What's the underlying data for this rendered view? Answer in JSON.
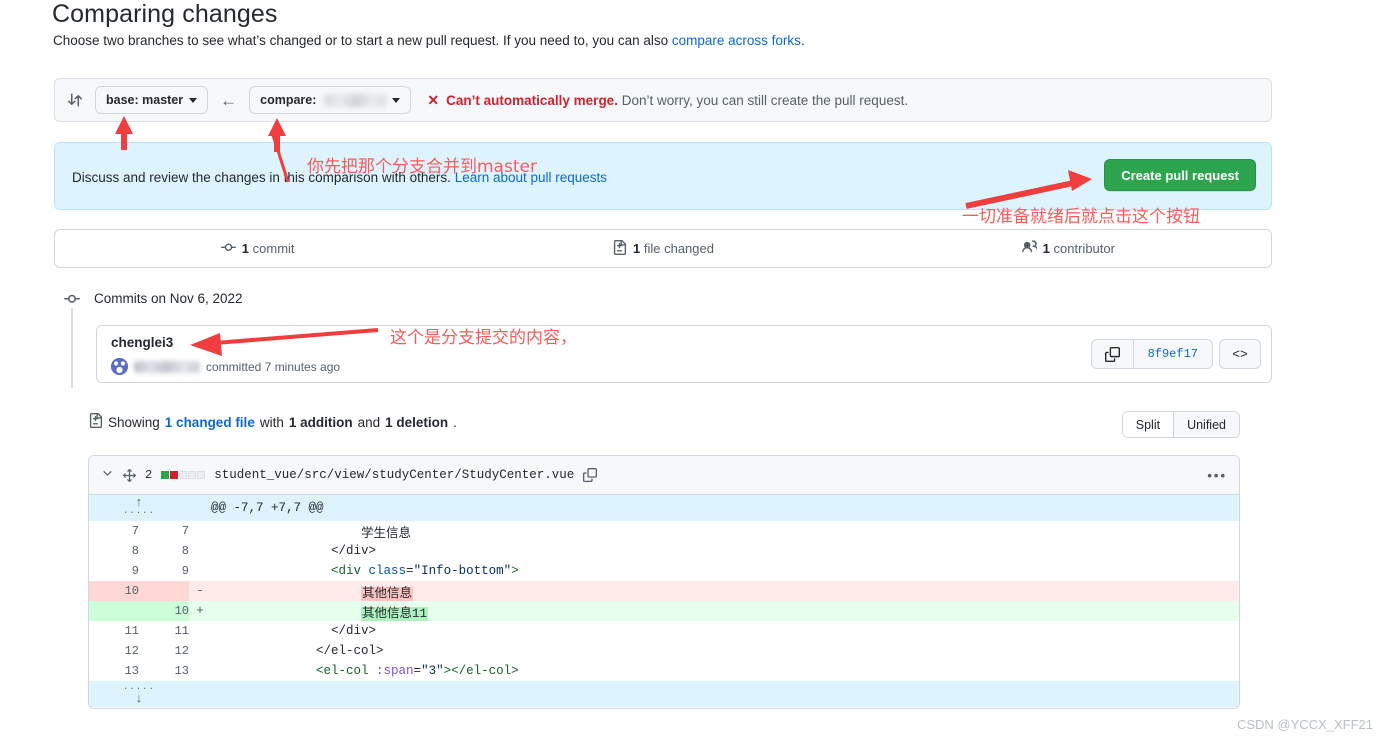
{
  "header": {
    "title": "Comparing changes",
    "subtitle_pre": "Choose two branches to see what’s changed or to start a new pull request. If you need to, you can also ",
    "subtitle_link": "compare across forks",
    "subtitle_post": "."
  },
  "branch_bar": {
    "compare_icon": "git-compare-icon",
    "base_label": "base: master",
    "arrow": "←",
    "compare_label": "compare:",
    "compare_value_blurred": true,
    "merge_x": "✕",
    "merge_status": "Can’t automatically merge.",
    "merge_rest": " Don’t worry, you can still create the pull request."
  },
  "info_banner": {
    "text": "Discuss and review the changes in this comparison with others. ",
    "link": "Learn about pull requests",
    "create_pr_label": "Create pull request"
  },
  "stats": [
    {
      "icon": "commit-icon",
      "count": "1",
      "label": "commit"
    },
    {
      "icon": "file-diff-icon",
      "count": "1",
      "label": "file changed"
    },
    {
      "icon": "people-icon",
      "count": "1",
      "label": "contributor"
    }
  ],
  "commits": {
    "date_header": "Commits on Nov 6, 2022",
    "message": "chenglei3",
    "author_blurred": true,
    "committed_text": "committed 7 minutes ago",
    "sha": "8f9ef17",
    "copy_icon": "copy-icon",
    "code_icon": "<>"
  },
  "showing": {
    "icon": "file-diff-icon",
    "pre": "Showing ",
    "changed_file": "1 changed file",
    "mid": " with ",
    "additions": "1 addition",
    "and": " and ",
    "deletions": "1 deletion",
    "end": ".",
    "split_label": "Split",
    "unified_label": "Unified"
  },
  "diff": {
    "chevron_icon": "chevron-down-icon",
    "move_icon": "move-icon",
    "stat_count": "2",
    "stat_blocks": [
      "add",
      "del",
      "neutral",
      "neutral",
      "neutral"
    ],
    "file_path": "student_vue/src/view/studyCenter/StudyCenter.vue",
    "copy_icon": "copy-icon",
    "kebab_icon": "kebab-horizontal-icon",
    "hunk_header": "@@ -7,7 +7,7 @@",
    "expand_up_icon": "↑",
    "expand_down_icon": "↓",
    "rows": [
      {
        "type": "ctx",
        "old": "7",
        "new": "7",
        "marker": "",
        "code": "                    学生信息"
      },
      {
        "type": "ctx",
        "old": "8",
        "new": "8",
        "marker": "",
        "code": "                </div>"
      },
      {
        "type": "ctx",
        "old": "9",
        "new": "9",
        "marker": "",
        "code": "                <div class=\"Info-bottom\">"
      },
      {
        "type": "del",
        "old": "10",
        "new": "",
        "marker": "-",
        "code": "                    其他信息"
      },
      {
        "type": "add",
        "old": "",
        "new": "10",
        "marker": "+",
        "code": "                    其他信息11"
      },
      {
        "type": "ctx",
        "old": "11",
        "new": "11",
        "marker": "",
        "code": "                </div>"
      },
      {
        "type": "ctx",
        "old": "12",
        "new": "12",
        "marker": "",
        "code": "              </el-col>"
      },
      {
        "type": "ctx",
        "old": "13",
        "new": "13",
        "marker": "",
        "code": "              <el-col :span=\"3\"></el-col>"
      }
    ]
  },
  "annotations": {
    "merge_note": "你先把那个分支合并到master",
    "button_note": "一切准备就绪后就点击这个按钮",
    "commit_note": "这个是分支提交的内容，"
  },
  "watermark": "CSDN @YCCX_XFF21",
  "colors": {
    "accent_blue": "#0969da",
    "danger_red": "#cf222e",
    "success_green": "#2da44e",
    "banner_bg": "#ddf4ff",
    "annotation_red": "#fb5a5a"
  }
}
